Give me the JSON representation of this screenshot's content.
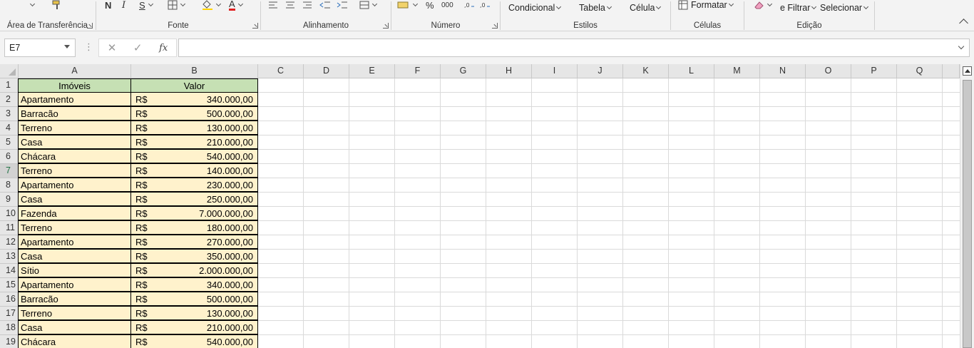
{
  "ribbon": {
    "clipboard": {
      "label": "Área de Transferência"
    },
    "font": {
      "label": "Fonte",
      "bold": "N",
      "italic": "I",
      "underline": "S",
      "font_color": "A"
    },
    "alignment": {
      "label": "Alinhamento"
    },
    "number": {
      "label": "Número",
      "percent": "%",
      "thousands": "000"
    },
    "styles": {
      "label": "Estilos",
      "conditional": "Condicional",
      "table": "Tabela",
      "cell": "Célula"
    },
    "cells": {
      "label": "Células",
      "format": "Formatar"
    },
    "editing": {
      "label": "Edição",
      "filter": "e Filtrar",
      "select": "Selecionar"
    }
  },
  "formula_bar": {
    "name_box": "E7",
    "fx": "fx",
    "content": ""
  },
  "columns": [
    "A",
    "B",
    "C",
    "D",
    "E",
    "F",
    "G",
    "H",
    "I",
    "J",
    "K",
    "L",
    "M",
    "N",
    "O",
    "P",
    "Q"
  ],
  "rows": [
    "1",
    "2",
    "3",
    "4",
    "5",
    "6",
    "7",
    "8",
    "9",
    "10",
    "11",
    "12",
    "13",
    "14",
    "15",
    "16",
    "17",
    "18",
    "19"
  ],
  "table": {
    "headers": [
      "Imóveis",
      "Valor"
    ],
    "currency": "R$",
    "rows": [
      {
        "type": "Apartamento",
        "value": "340.000,00"
      },
      {
        "type": "Barracão",
        "value": "500.000,00"
      },
      {
        "type": "Terreno",
        "value": "130.000,00"
      },
      {
        "type": "Casa",
        "value": "210.000,00"
      },
      {
        "type": "Chácara",
        "value": "540.000,00"
      },
      {
        "type": "Terreno",
        "value": "140.000,00"
      },
      {
        "type": "Apartamento",
        "value": "230.000,00"
      },
      {
        "type": "Casa",
        "value": "250.000,00"
      },
      {
        "type": "Fazenda",
        "value": "7.000.000,00"
      },
      {
        "type": "Terreno",
        "value": "180.000,00"
      },
      {
        "type": "Apartamento",
        "value": "270.000,00"
      },
      {
        "type": "Casa",
        "value": "350.000,00"
      },
      {
        "type": "Sítio",
        "value": "2.000.000,00"
      },
      {
        "type": "Apartamento",
        "value": "340.000,00"
      },
      {
        "type": "Barracão",
        "value": "500.000,00"
      },
      {
        "type": "Terreno",
        "value": "130.000,00"
      },
      {
        "type": "Casa",
        "value": "210.000,00"
      },
      {
        "type": "Chácara",
        "value": "540.000,00"
      }
    ]
  },
  "colors": {
    "header_fill": "#c6e0b4",
    "data_fill": "#fff2cc",
    "selected_row_accent": "#217346",
    "font_color_accent": "#e02020"
  }
}
